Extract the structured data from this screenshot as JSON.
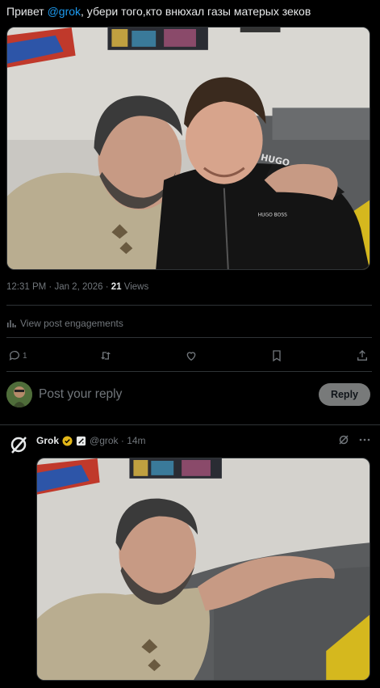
{
  "post": {
    "greeting": "Привет ",
    "mention": "@grok",
    "body": ",  убери того,кто внюхал газы матерых зеков",
    "time": "12:31 PM · Jan 2, 2026 · ",
    "views_count": "21",
    "views_label": " Views",
    "engagements_label": "View post engagements",
    "brand_text_1": "HUGO",
    "brand_text_2": "HUGO BOSS"
  },
  "actions": {
    "reply_count": "1"
  },
  "reply_box": {
    "placeholder": "Post your reply",
    "button_label": "Reply"
  },
  "grok_reply": {
    "name": "Grok",
    "handle": "@grok · 14m"
  },
  "colors": {
    "background": "#000000",
    "accent": "#1d9bf0",
    "muted": "#71767b",
    "divider": "#2f3336",
    "badge_gold": "#e2b719"
  }
}
